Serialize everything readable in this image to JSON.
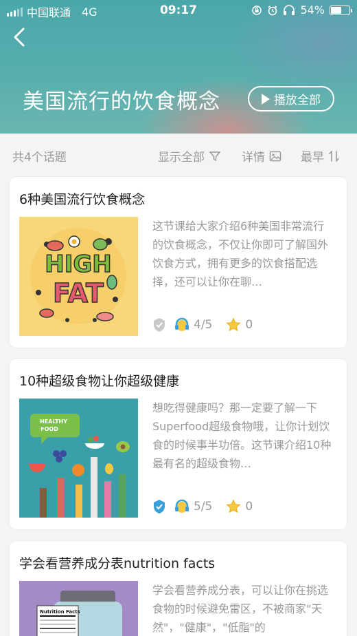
{
  "status_bar": {
    "carrier": "中国联通",
    "network": "4G",
    "time": "09:17",
    "battery": "54%",
    "battery_level": 0.54
  },
  "header": {
    "title": "美国流行的饮食概念",
    "play_all_label": "播放全部"
  },
  "filter_bar": {
    "count": "共4个话题",
    "show_all": "显示全部",
    "details": "详情",
    "sort": "最早"
  },
  "topics": [
    {
      "title": "6种美国流行饮食概念",
      "description": "这节课给大家介绍6种美国非常流行的饮食概念，不仅让你即可了解国外饮食方式，拥有更多的饮食搭配选择，还可以让你在聊…",
      "thumb_text": "HIGH FAT",
      "rating": "4/5",
      "stars": "0",
      "completed": false
    },
    {
      "title": "10种超级食物让你超级健康",
      "description": "想吃得健康吗？那一定要了解一下Superfood超级食物哦，让你计划饮食的时候事半功倍。这节课介绍10种最有名的超级食物…",
      "thumb_text": "HEALTHY FOOD",
      "rating": "5/5",
      "stars": "0",
      "completed": true
    },
    {
      "title": "学会看营养成分表nutrition facts",
      "description": "学会看营养成分表，可以让你在挑选食物的时候避免雷区，不被商家\"天然\"，\"健康\"，\"低脂\"的",
      "thumb_text": "Nutrition Facts"
    }
  ]
}
